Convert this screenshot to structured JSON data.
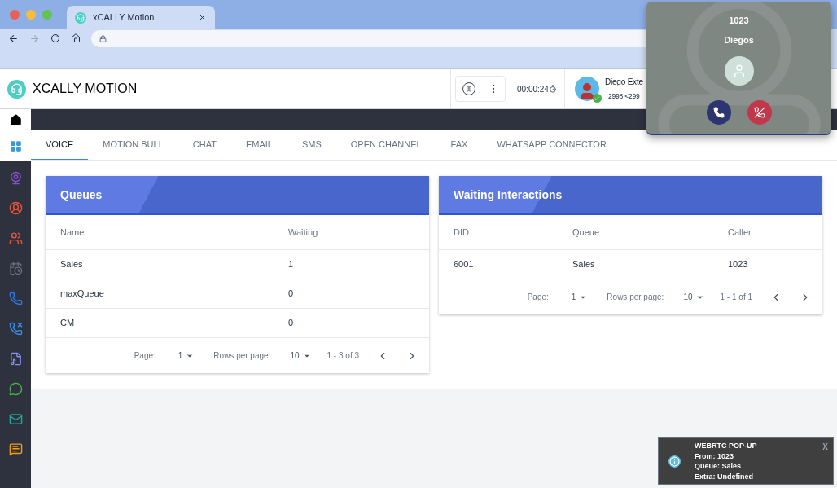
{
  "browser": {
    "tab_title": "xCALLY Motion"
  },
  "header": {
    "title": "XCALLY MOTION",
    "timer": "00:00:24",
    "user": {
      "name": "Diego Exte",
      "extension": "2998 <299",
      "online": true
    }
  },
  "tabs": [
    {
      "label": "VOICE",
      "selected": true
    },
    {
      "label": "MOTION BULL",
      "selected": false
    },
    {
      "label": "CHAT",
      "selected": false
    },
    {
      "label": "EMAIL",
      "selected": false
    },
    {
      "label": "SMS",
      "selected": false
    },
    {
      "label": "OPEN CHANNEL",
      "selected": false
    },
    {
      "label": "FAX",
      "selected": false
    },
    {
      "label": "WHATSAPP CONNECTOR",
      "selected": false
    }
  ],
  "cards": [
    {
      "title": "Queues",
      "columns": [
        "Name",
        "Waiting"
      ],
      "rows": [
        [
          "Sales",
          "1"
        ],
        [
          "maxQueue",
          "0"
        ],
        [
          "CM",
          "0"
        ]
      ],
      "pagination": {
        "page_label": "Page:",
        "page": "1",
        "rows_label": "Rows per page:",
        "rows": "10",
        "range": "1 - 3 of 3"
      }
    },
    {
      "title": "Waiting Interactions",
      "columns": [
        "DID",
        "Queue",
        "Caller"
      ],
      "rows": [
        [
          "6001",
          "Sales",
          "1023"
        ]
      ],
      "pagination": {
        "page_label": "Page:",
        "page": "1",
        "rows_label": "Rows per page:",
        "rows": "10",
        "range": "1 - 1 of 1"
      }
    }
  ],
  "call_popup": {
    "number": "1023",
    "name": "Diegos"
  },
  "toast": {
    "title": "WEBRTC POP-UP",
    "lines": [
      "From: 1023",
      "Queue: Sales",
      "Extra: Undefined"
    ],
    "close": "X"
  }
}
